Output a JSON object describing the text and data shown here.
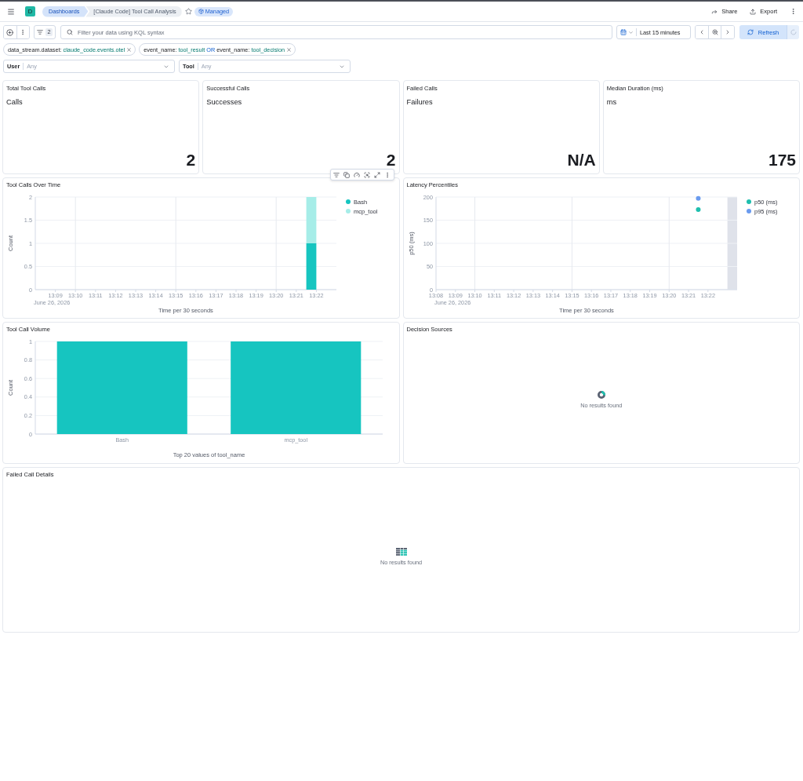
{
  "header": {
    "space_avatar": "D",
    "breadcrumbs": [
      "Dashboards",
      "[Claude Code] Tool Call Analysis"
    ],
    "favorite": false,
    "badge": "Managed",
    "actions": [
      {
        "kind": "share",
        "label": "Share"
      },
      {
        "kind": "export",
        "label": "Export"
      }
    ]
  },
  "query_bar": {
    "filter_count": "2",
    "search": {
      "placeholder": "Filter your data using KQL syntax"
    },
    "time_range": "Last 15 minutes",
    "refresh": "Refresh"
  },
  "filters": [
    {
      "parts": [
        {
          "kind": "field",
          "text": "data_stream.dataset:"
        },
        {
          "kind": "value",
          "text": "claude_code.events.otel"
        }
      ]
    },
    {
      "parts": [
        {
          "kind": "field",
          "text": "event_name:"
        },
        {
          "kind": "value",
          "text": "tool_result"
        },
        {
          "kind": "operator",
          "text": "OR"
        },
        {
          "kind": "field",
          "text": "event_name:"
        },
        {
          "kind": "value",
          "text": "tool_decision"
        }
      ]
    }
  ],
  "controls": [
    {
      "label": "User",
      "placeholder": "Any"
    },
    {
      "label": "Tool",
      "placeholder": "Any"
    }
  ],
  "panels": [
    {
      "kind": "metric",
      "title": "Total Tool Calls",
      "subtitle": "Calls",
      "value": "2",
      "hovered": false
    },
    {
      "kind": "metric",
      "title": "Successful Calls",
      "subtitle": "Successes",
      "value": "2",
      "hovered": false
    },
    {
      "kind": "metric",
      "title": "Failed Calls",
      "subtitle": "Failures",
      "value": "N/A",
      "hovered": false
    },
    {
      "kind": "metric",
      "title": "Median Duration (ms)",
      "subtitle": "ms",
      "value": "175",
      "hovered": false
    },
    {
      "kind": "chart",
      "hovered": true,
      "partial_bucket": false,
      "date_label": "June 26, 2026",
      "chart_data": {
        "type": "bar",
        "title": "Tool Calls Over Time",
        "xlabel": "Time per 30 seconds",
        "ylabel": "Count",
        "stacked": true,
        "grid": true,
        "legend": "right",
        "x": [
          801.75
        ],
        "series": [
          {
            "name": "Bash",
            "color": "#16c5c0",
            "values": [
              1
            ]
          },
          {
            "name": "mcp_tool",
            "color": "#a6ede8",
            "values": [
              1
            ]
          }
        ],
        "xlim": [
          788,
          803
        ],
        "ylim": [
          0,
          2
        ],
        "xticks": [
          {
            "value": 789,
            "label": "13:09"
          },
          {
            "value": 790,
            "label": "13:10"
          },
          {
            "value": 791,
            "label": "13:11"
          },
          {
            "value": 792,
            "label": "13:12"
          },
          {
            "value": 793,
            "label": "13:13"
          },
          {
            "value": 794,
            "label": "13:14"
          },
          {
            "value": 795,
            "label": "13:15"
          },
          {
            "value": 796,
            "label": "13:16"
          },
          {
            "value": 797,
            "label": "13:17"
          },
          {
            "value": 798,
            "label": "13:18"
          },
          {
            "value": 799,
            "label": "13:19"
          },
          {
            "value": 800,
            "label": "13:20"
          },
          {
            "value": 801,
            "label": "13:21"
          },
          {
            "value": 802,
            "label": "13:22"
          }
        ],
        "yticks": [
          0,
          0.5,
          1,
          1.5,
          2
        ]
      }
    },
    {
      "kind": "chart",
      "hovered": false,
      "partial_bucket": true,
      "date_label": "June 26, 2026",
      "chart_data": {
        "type": "scatter",
        "title": "Latency Percentiles",
        "xlabel": "Time per 30 seconds",
        "ylabel": "p50 (ms)",
        "grid": true,
        "legend": "right",
        "x": [
          801.5
        ],
        "series": [
          {
            "name": "p50 (ms)",
            "color": "#1fbfae",
            "values": [
              173
            ]
          },
          {
            "name": "p95 (ms)",
            "color": "#6a9bef",
            "values": [
              197
            ]
          }
        ],
        "xlim": [
          788,
          803.5
        ],
        "ylim": [
          0,
          200
        ],
        "xticks": [
          {
            "value": 788,
            "label": "13:08"
          },
          {
            "value": 789,
            "label": "13:09"
          },
          {
            "value": 790,
            "label": "13:10"
          },
          {
            "value": 791,
            "label": "13:11"
          },
          {
            "value": 792,
            "label": "13:12"
          },
          {
            "value": 793,
            "label": "13:13"
          },
          {
            "value": 794,
            "label": "13:14"
          },
          {
            "value": 795,
            "label": "13:15"
          },
          {
            "value": 796,
            "label": "13:16"
          },
          {
            "value": 797,
            "label": "13:17"
          },
          {
            "value": 798,
            "label": "13:18"
          },
          {
            "value": 799,
            "label": "13:19"
          },
          {
            "value": 800,
            "label": "13:20"
          },
          {
            "value": 801,
            "label": "13:21"
          },
          {
            "value": 802,
            "label": "13:22"
          }
        ],
        "yticks": [
          0,
          50,
          100,
          150,
          200
        ]
      }
    },
    {
      "kind": "chart",
      "hovered": false,
      "partial_bucket": false,
      "chart_data": {
        "type": "bar",
        "title": "Tool Call Volume",
        "xlabel": "Top 20 values of tool_name",
        "ylabel": "Count",
        "grid": true,
        "categories": [
          "Bash",
          "mcp_tool"
        ],
        "series": [
          {
            "color": "#16c5c0",
            "values": [
              1,
              1
            ]
          }
        ],
        "ylim": [
          0,
          1
        ],
        "yticks": [
          0,
          0.2,
          0.4,
          0.6,
          0.8,
          1
        ]
      }
    },
    {
      "kind": "pie",
      "title": "Decision Sources",
      "message": "No results found",
      "hovered": false
    },
    {
      "kind": "table",
      "title": "Failed Call Details",
      "message": "No results found",
      "hovered": false
    }
  ]
}
